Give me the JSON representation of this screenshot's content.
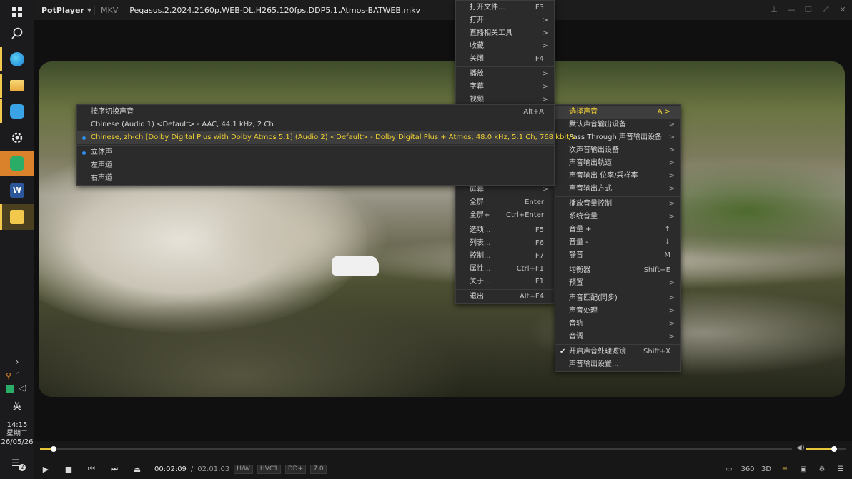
{
  "taskbar": {
    "apps": [
      {
        "name": "windows-start",
        "color": "#3a9bdc"
      },
      {
        "name": "search",
        "color": "#9a9a9a"
      },
      {
        "name": "edge",
        "color": "#2bb3a8"
      },
      {
        "name": "file-explorer",
        "color": "#f2c94c"
      },
      {
        "name": "sync",
        "color": "#3a9bdc"
      },
      {
        "name": "settings",
        "color": "#cccccc"
      },
      {
        "name": "wechat",
        "color": "#2aae67"
      },
      {
        "name": "word",
        "color": "#2b579a"
      },
      {
        "name": "potplayer",
        "color": "#f2c94c"
      }
    ],
    "ime": "英",
    "time": "14:15",
    "weekday": "星期二",
    "date": "26/05/26",
    "notification_count": "2"
  },
  "titlebar": {
    "app": "PotPlayer",
    "format": "MKV",
    "filename": "Pegasus.2.2024.2160p.WEB-DL.H265.120fps.DDP5.1.Atmos-BATWEB.mkv"
  },
  "controls": {
    "current": "00:02:09",
    "separator": "/",
    "total": "02:01:03",
    "badges": [
      "H/W",
      "HVC1",
      "DD+",
      "7.0"
    ],
    "progress": 0.018,
    "volume": 0.7,
    "right_icons": [
      "cast-icon",
      "360",
      "3D",
      "equalizer-icon",
      "playlist-icon",
      "settings-icon",
      "menu-icon"
    ]
  },
  "main_menu": [
    {
      "label": "打开文件...",
      "shortcut": "F3"
    },
    {
      "label": "打开",
      "arrow": ">"
    },
    {
      "label": "直播相关工具",
      "arrow": ">"
    },
    {
      "label": "收藏",
      "arrow": ">"
    },
    {
      "label": "关闭",
      "shortcut": "F4",
      "sep_after": true
    },
    {
      "label": "播放",
      "arrow": ">"
    },
    {
      "label": "字幕",
      "arrow": ">"
    },
    {
      "label": "视频",
      "arrow": ">"
    },
    {
      "label": "屏幕",
      "arrow": ">",
      "top_gap": true
    },
    {
      "label": "全屏",
      "shortcut": "Enter"
    },
    {
      "label": "全屏+",
      "shortcut": "Ctrl+Enter",
      "sep_after": true
    },
    {
      "label": "选项...",
      "shortcut": "F5"
    },
    {
      "label": "列表...",
      "shortcut": "F6"
    },
    {
      "label": "控制...",
      "shortcut": "F7"
    },
    {
      "label": "属性...",
      "shortcut": "Ctrl+F1"
    },
    {
      "label": "关于...",
      "shortcut": "F1",
      "sep_after": true
    },
    {
      "label": "退出",
      "shortcut": "Alt+F4"
    }
  ],
  "audio_menu": [
    {
      "label": "选择声音",
      "shortcut": "A >",
      "highlight": true
    },
    {
      "label": "默认声音输出设备",
      "arrow": ">"
    },
    {
      "label": "Pass Through 声音输出设备",
      "arrow": ">"
    },
    {
      "label": "次声音输出设备",
      "arrow": ">"
    },
    {
      "label": "声音输出轨道",
      "arrow": ">"
    },
    {
      "label": "声音输出 位率/采样率",
      "arrow": ">"
    },
    {
      "label": "声音输出方式",
      "arrow": ">",
      "sep_after": true
    },
    {
      "label": "播放音量控制",
      "arrow": ">"
    },
    {
      "label": "系统音量",
      "arrow": ">"
    },
    {
      "label": "音量 +",
      "shortcut": "↑"
    },
    {
      "label": "音量 -",
      "shortcut": "↓"
    },
    {
      "label": "静音",
      "shortcut": "M",
      "sep_after": true
    },
    {
      "label": "均衡器",
      "shortcut": "Shift+E"
    },
    {
      "label": "预置",
      "arrow": ">",
      "sep_after": true
    },
    {
      "label": "声音匹配(同步)",
      "arrow": ">"
    },
    {
      "label": "声音处理",
      "arrow": ">"
    },
    {
      "label": "音轨",
      "arrow": ">"
    },
    {
      "label": "音调",
      "arrow": ">",
      "sep_after": true
    },
    {
      "label": "开启声音处理滤镜",
      "shortcut": "Shift+X",
      "check": true
    },
    {
      "label": "声音输出设置..."
    }
  ],
  "select_audio_menu": [
    {
      "label": "按序切换声音",
      "shortcut": "Alt+A"
    },
    {
      "label": "Chinese (Audio 1) <Default> - AAC, 44.1 kHz, 2 Ch"
    },
    {
      "label": "Chinese, zh-ch [Dolby Digital Plus with Dolby Atmos 5.1] (Audio 2) <Default> - Dolby Digital Plus + Atmos, 48.0 kHz, 5.1 Ch, 768 kbit/s",
      "selected": true,
      "highlight": true,
      "sep_after": true
    },
    {
      "label": "立体声",
      "selected": true
    },
    {
      "label": "左声道"
    },
    {
      "label": "右声道"
    }
  ]
}
